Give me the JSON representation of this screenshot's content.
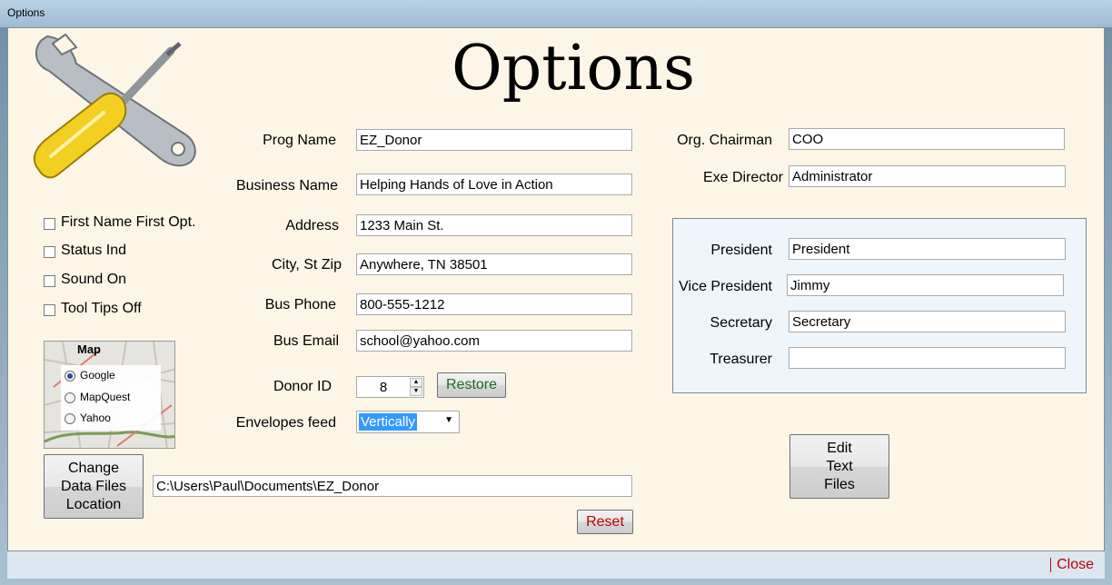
{
  "window": {
    "title": "Options"
  },
  "heading": "Options",
  "options": {
    "first_name_first": "First Name First Opt.",
    "status_ind": "Status Ind",
    "sound_on": "Sound On",
    "tool_tips_off": "Tool Tips Off"
  },
  "map": {
    "label": "Map",
    "choices": [
      "Google",
      "MapQuest",
      "Yahoo"
    ],
    "selected": "Google"
  },
  "fields": {
    "prog_name": {
      "label": "Prog Name",
      "value": "EZ_Donor"
    },
    "business_name": {
      "label": "Business Name",
      "value": "Helping Hands of Love in Action"
    },
    "address": {
      "label": "Address",
      "value": "1233 Main St."
    },
    "city_st_zip": {
      "label": "City, St Zip",
      "value": "Anywhere, TN 38501"
    },
    "bus_phone": {
      "label": "Bus Phone",
      "value": "800-555-1212"
    },
    "bus_email": {
      "label": "Bus Email",
      "value": "school@yahoo.com"
    },
    "donor_id": {
      "label": "Donor ID",
      "value": "8"
    },
    "envelopes_feed": {
      "label": "Envelopes feed",
      "value": "Vertically"
    }
  },
  "org": {
    "chairman": {
      "label": "Org. Chairman",
      "value": "COO"
    },
    "exe_director": {
      "label": "Exe Director",
      "value": "Administrator"
    }
  },
  "officers": {
    "president": {
      "label": "President",
      "value": "President"
    },
    "vice_president": {
      "label": "Vice President",
      "value": "Jimmy"
    },
    "secretary": {
      "label": "Secretary",
      "value": "Secretary"
    },
    "treasurer": {
      "label": "Treasurer",
      "value": ""
    }
  },
  "buttons": {
    "restore": "Restore",
    "change_location": [
      "Change",
      "Data Files",
      "Location"
    ],
    "reset": "Reset",
    "edit_text_files": [
      "Edit",
      "Text",
      "Files"
    ],
    "close": "Close"
  },
  "data_path": "C:\\Users\\Paul\\Documents\\EZ_Donor",
  "colors": {
    "background": "#fdf6e7",
    "officers_panel": "#eef5fb",
    "restore_text": "#1f6b1f",
    "reset_text": "#c00000",
    "close_text": "#c00000",
    "selection": "#3399ff"
  }
}
